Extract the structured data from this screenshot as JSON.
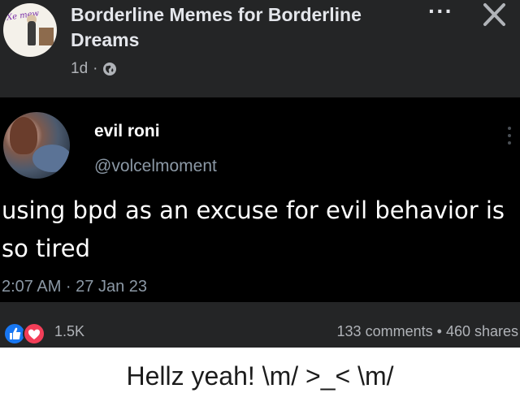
{
  "post": {
    "page_name": "Borderline Memes for Borderline Dreams",
    "time": "1d",
    "separator": "·",
    "audience_icon": "globe-icon",
    "more_icon": "more-options-icon",
    "close_icon": "close-icon"
  },
  "tweet": {
    "display_name": "evil roni",
    "handle": "@volcelmoment",
    "text": "using bpd as an excuse for evil behavior is so tired",
    "timestamp": "2:07 AM · 27 Jan 23"
  },
  "stats": {
    "reactions": [
      "like-icon",
      "love-icon"
    ],
    "reaction_count": "1.5K",
    "comments": "133 comments",
    "dot": "•",
    "shares": "460 shares"
  },
  "caption": "Hellz yeah! \\m/ >_< \\m/",
  "colors": {
    "card_bg": "#242526",
    "tweet_bg": "#000000",
    "like_blue": "#1877f2",
    "love_red": "#f33e58",
    "page_bg": "#ffffff"
  }
}
